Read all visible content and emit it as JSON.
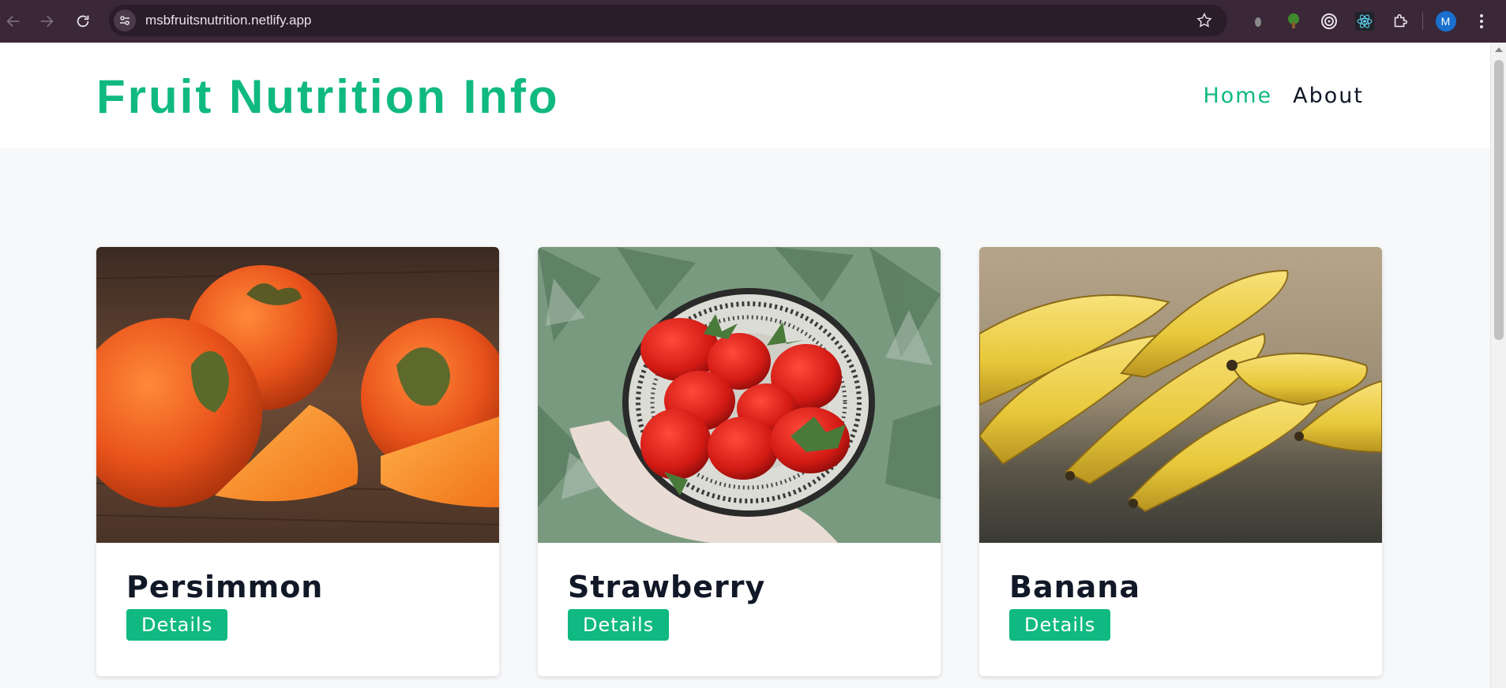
{
  "browser": {
    "url": "msbfruitsnutrition.netlify.app",
    "profile_initial": "M",
    "icons": [
      "back-icon",
      "forward-icon",
      "reload-icon",
      "site-info-icon",
      "bookmark-star-icon",
      "extension-dot-icon",
      "extension-tree-icon",
      "extension-target-icon",
      "react-devtools-icon",
      "extensions-puzzle-icon",
      "menu-dots-icon"
    ]
  },
  "site": {
    "brand": "Fruit Nutrition Info",
    "nav": {
      "home": "Home",
      "about": "About"
    }
  },
  "cards": [
    {
      "title": "Persimmon",
      "button": "Details"
    },
    {
      "title": "Strawberry",
      "button": "Details"
    },
    {
      "title": "Banana",
      "button": "Details"
    }
  ],
  "colors": {
    "accent": "#10b981",
    "chrome": "#3a2738",
    "text": "#111827"
  }
}
